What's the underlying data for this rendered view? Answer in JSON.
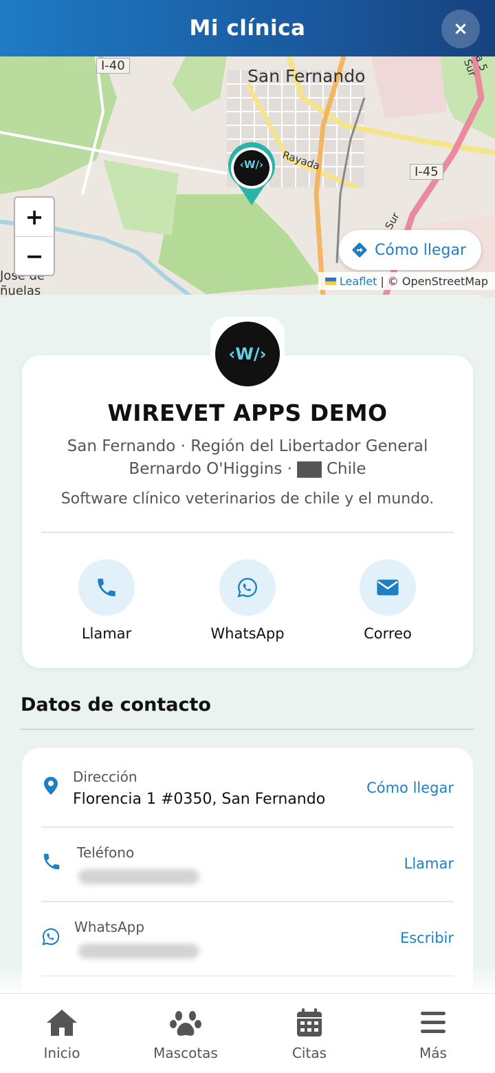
{
  "header": {
    "title": "Mi clínica",
    "close_label": "×"
  },
  "map": {
    "labels": {
      "city": "San Fernando",
      "highway_i40": "I-40",
      "highway_i45": "I-45",
      "street_rayada": "Rayada",
      "street_sur_top": "a 5 Sur",
      "street_sur_mid": "Sur",
      "place_jose": "José de",
      "place_nuelas": "ñuelas"
    },
    "zoom_in": "+",
    "zoom_out": "−",
    "directions_label": "Cómo llegar",
    "attribution_link": "Leaflet",
    "attribution_sep": "|",
    "attribution_text": "© OpenStreetMap",
    "marker_logo": "‹W/›"
  },
  "clinic": {
    "logo_text": "‹W/›",
    "name": "WIREVET APPS DEMO",
    "location_line1": "San Fernando · Región del Libertador General",
    "location_line2": "Bernardo O'Higgins · ▇▇ Chile",
    "description": "Software clínico veterinarios de chile y el mundo."
  },
  "actions": [
    {
      "label": "Llamar",
      "icon": "phone-icon"
    },
    {
      "label": "WhatsApp",
      "icon": "whatsapp-icon"
    },
    {
      "label": "Correo",
      "icon": "envelope-icon"
    }
  ],
  "contact": {
    "section_title": "Datos de contacto",
    "rows": [
      {
        "label": "Dirección",
        "value": "Florencia 1 #0350, San Fernando",
        "action": "Cómo llegar",
        "icon": "map-pin-icon"
      },
      {
        "label": "Teléfono",
        "value": "",
        "action": "Llamar",
        "icon": "phone-icon"
      },
      {
        "label": "WhatsApp",
        "value": "",
        "action": "Escribir",
        "icon": "whatsapp-icon"
      }
    ]
  },
  "nav": [
    {
      "label": "Inicio",
      "icon": "home-icon"
    },
    {
      "label": "Mascotas",
      "icon": "paw-icon"
    },
    {
      "label": "Citas",
      "icon": "calendar-icon"
    },
    {
      "label": "Más",
      "icon": "menu-icon"
    }
  ],
  "colors": {
    "header_start": "#1e7bc4",
    "header_end": "#17427f",
    "accent": "#1f7fc4",
    "marker": "#2bb3a8",
    "background": "#eaf3ef"
  }
}
